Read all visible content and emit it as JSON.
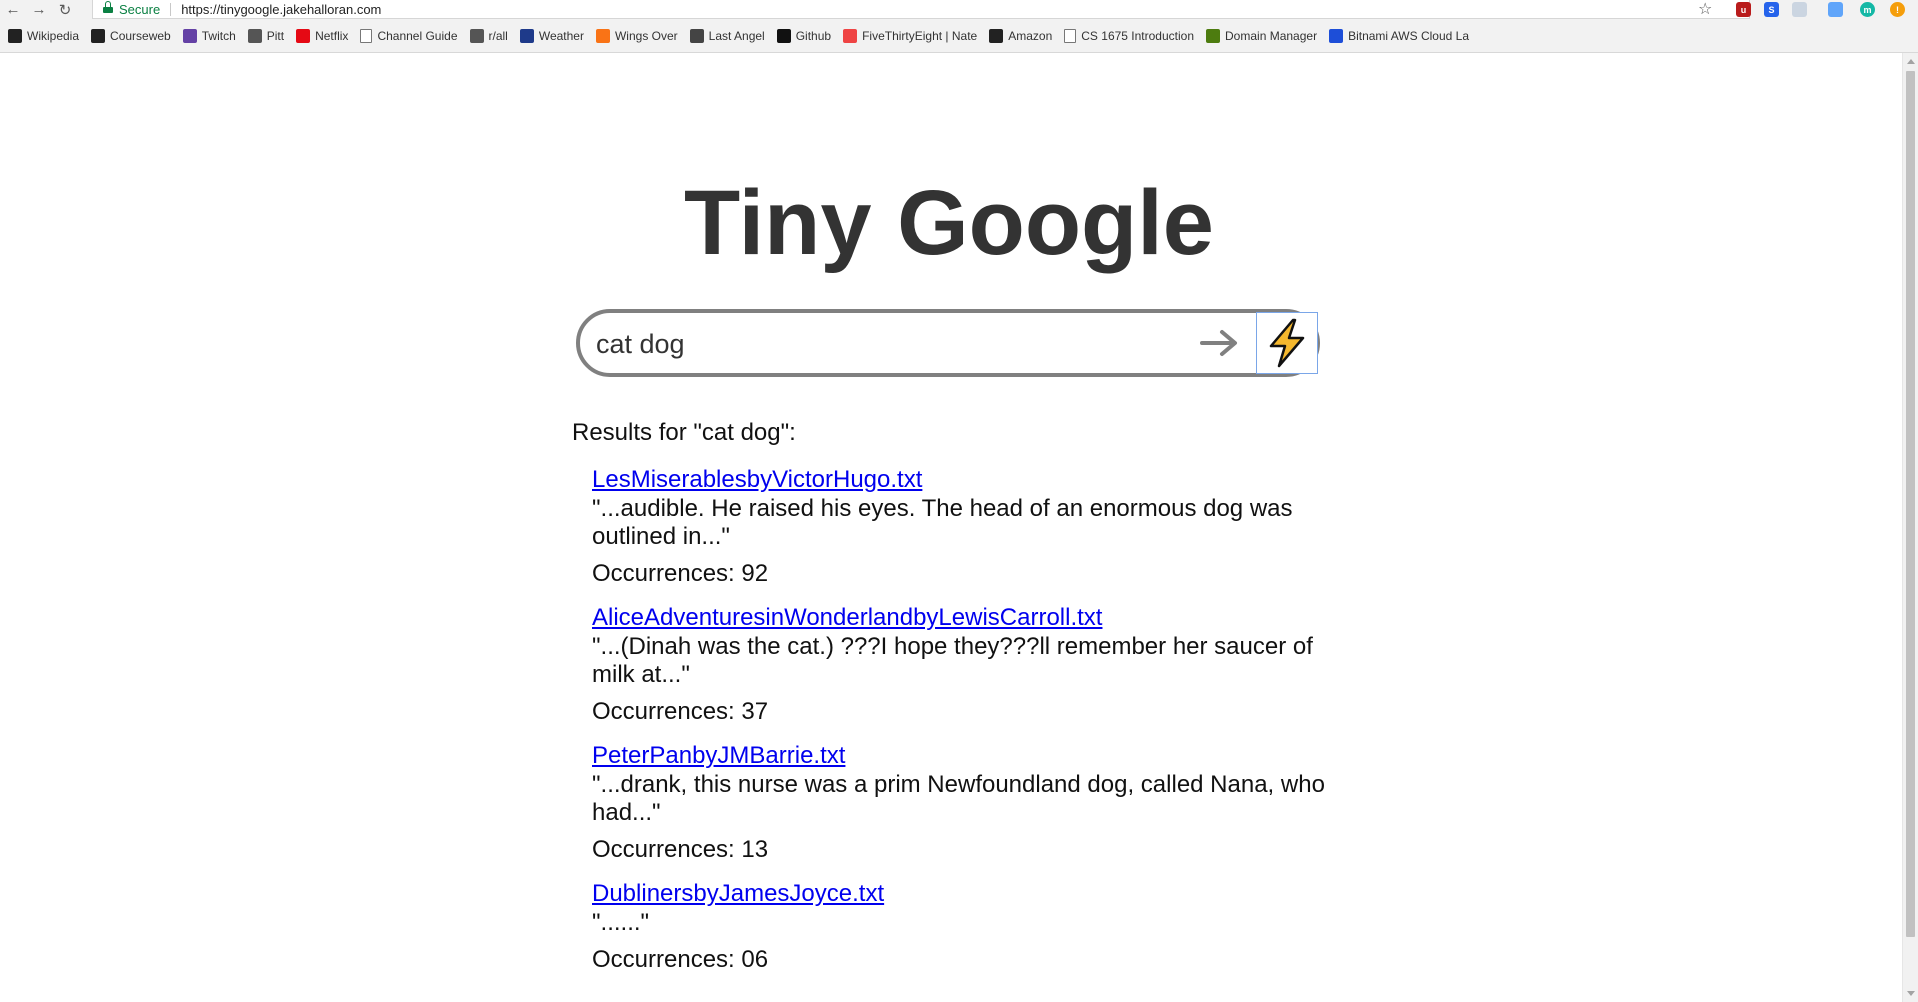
{
  "browser": {
    "security_label": "Secure",
    "url": "https://tinygoogle.jakehalloran.com",
    "bookmarks": [
      {
        "label": "Wikipedia",
        "icon": "wikipedia-icon",
        "color": "#222222"
      },
      {
        "label": "Courseweb",
        "icon": "courseweb-icon",
        "color": "#222222"
      },
      {
        "label": "Twitch",
        "icon": "twitch-icon",
        "color": "#6441a5"
      },
      {
        "label": "Pitt",
        "icon": "pitt-icon",
        "color": "#555555"
      },
      {
        "label": "Netflix",
        "icon": "netflix-icon",
        "color": "#e50914"
      },
      {
        "label": "Channel Guide",
        "icon": "document-icon",
        "color": "#ffffff"
      },
      {
        "label": "r/all",
        "icon": "reddit-icon",
        "color": "#555555"
      },
      {
        "label": "Weather",
        "icon": "weather-icon",
        "color": "#1e3a8a"
      },
      {
        "label": "Wings Over",
        "icon": "wings-over-icon",
        "color": "#f97316"
      },
      {
        "label": "Last Angel",
        "icon": "last-angel-icon",
        "color": "#444444"
      },
      {
        "label": "Github",
        "icon": "github-icon",
        "color": "#111111"
      },
      {
        "label": "FiveThirtyEight | Nate",
        "icon": "fivethirtyeight-icon",
        "color": "#ef4444"
      },
      {
        "label": "Amazon",
        "icon": "amazon-icon",
        "color": "#222222"
      },
      {
        "label": "CS 1675 Introduction",
        "icon": "document-icon",
        "color": "#ffffff"
      },
      {
        "label": "Domain Manager",
        "icon": "domain-manager-icon",
        "color": "#4d7c0f"
      },
      {
        "label": "Bitnami AWS Cloud La",
        "icon": "bitnami-icon",
        "color": "#1d4ed8"
      }
    ]
  },
  "page": {
    "title": "Tiny Google",
    "search": {
      "value": "cat dog"
    },
    "results_heading": "Results for \"cat dog\":",
    "occurrences_label": "Occurrences:",
    "results": [
      {
        "file": "LesMiserablesbyVictorHugo.txt",
        "snippet": "\"...audible. He raised his eyes. The head of an enormous dog was outlined in...\"",
        "occurrences": "92"
      },
      {
        "file": "AliceAdventuresinWonderlandbyLewisCarroll.txt",
        "snippet": "\"...(Dinah was the cat.) ???I hope they???ll remember her saucer of milk at...\"",
        "occurrences": "37"
      },
      {
        "file": "PeterPanbyJMBarrie.txt",
        "snippet": "\"...drank, this nurse was a prim Newfoundland dog, called Nana, who had...\"",
        "occurrences": "13"
      },
      {
        "file": "DublinersbyJamesJoyce.txt",
        "snippet": "\"......\"",
        "occurrences": "06"
      }
    ]
  }
}
